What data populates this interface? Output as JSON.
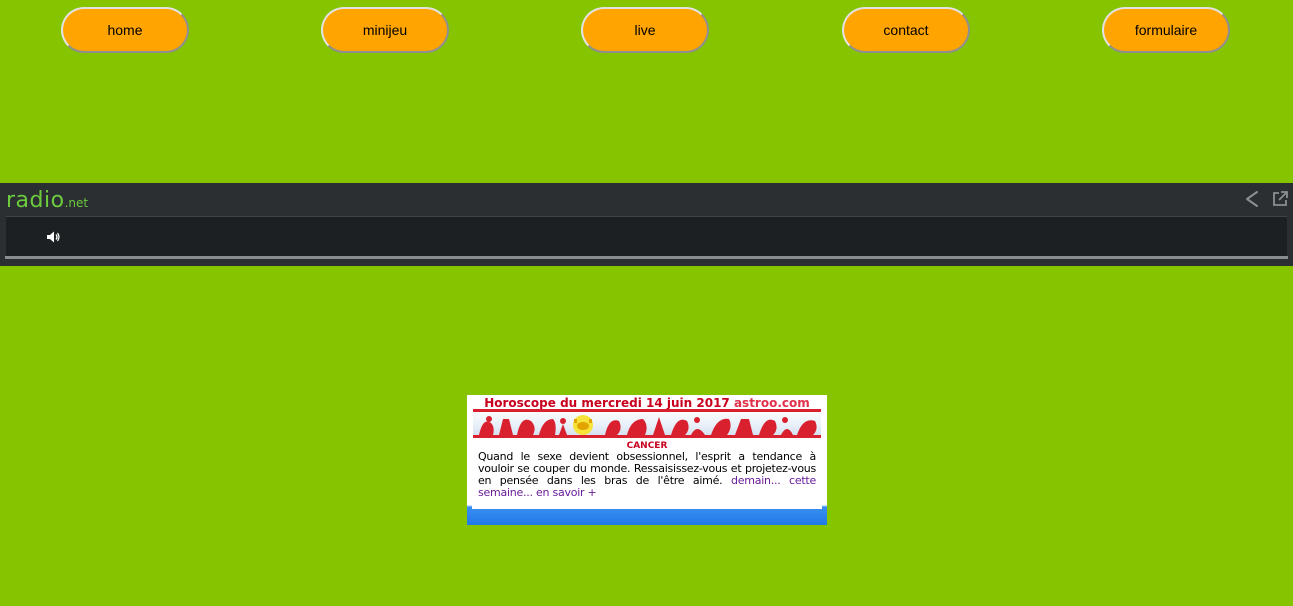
{
  "nav": {
    "items": [
      {
        "label": "home"
      },
      {
        "label": "minijeu"
      },
      {
        "label": "live"
      },
      {
        "label": "contact"
      },
      {
        "label": "formulaire"
      }
    ]
  },
  "player": {
    "logo_main": "radio",
    "logo_suffix": ".net",
    "icons": [
      "share-icon",
      "external-link-icon",
      "volume-icon"
    ]
  },
  "horoscope": {
    "title": "Horoscope du mercredi 14 juin 2017",
    "site": "astroo.com",
    "sign": "CANCER",
    "text": "Quand le sexe devient obsessionnel, l'esprit a tendance à vouloir se couper du monde. Ressaisissez-vous et projetez-vous en pensée dans les bras de l'être aimé.",
    "link_tomorrow": "demain...",
    "link_week": "cette semaine...",
    "link_more": "en savoir +"
  },
  "colors": {
    "background": "#86c400",
    "nav_button": "#ffa400",
    "player_bg": "#2b2f31",
    "logo_green": "#6ccb3f",
    "horoscope_red": "#c8001e",
    "horoscope_link": "#6a1b9a"
  }
}
